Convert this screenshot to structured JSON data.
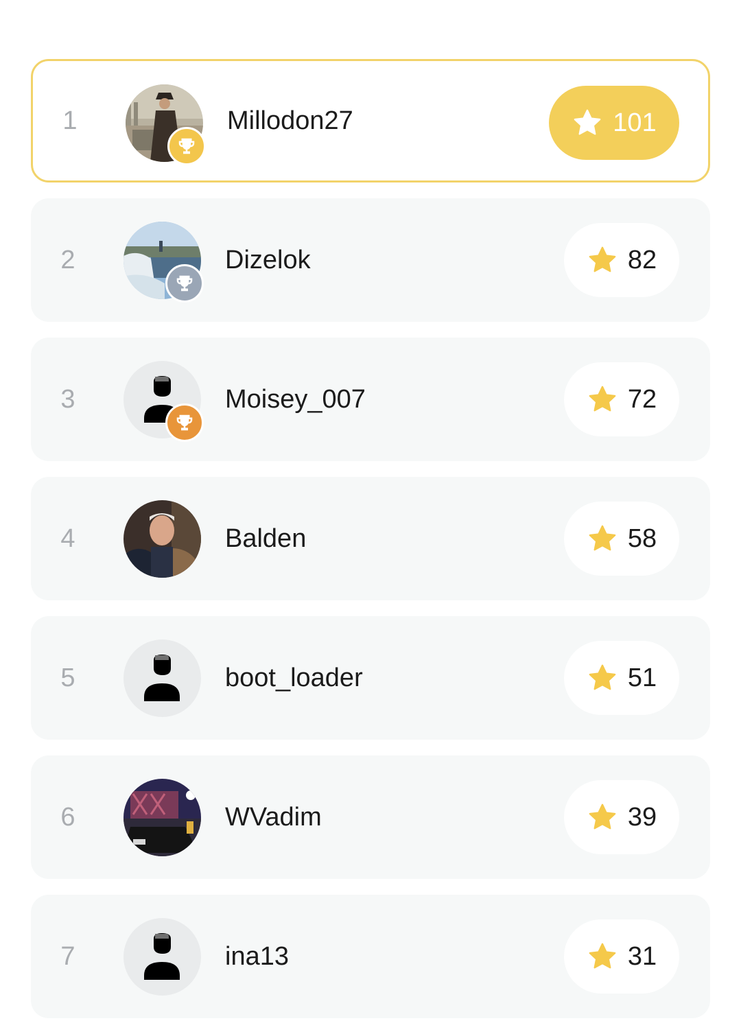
{
  "leaderboard": [
    {
      "rank": "1",
      "name": "Millodon27",
      "score": "101",
      "avatar": "photo-man-coat",
      "trophy": "gold"
    },
    {
      "rank": "2",
      "name": "Dizelok",
      "score": "82",
      "avatar": "photo-ice-river",
      "trophy": "silver"
    },
    {
      "rank": "3",
      "name": "Moisey_007",
      "score": "72",
      "avatar": "default-user-icon",
      "trophy": "bronze"
    },
    {
      "rank": "4",
      "name": "Balden",
      "score": "58",
      "avatar": "photo-face",
      "trophy": null
    },
    {
      "rank": "5",
      "name": "boot_loader",
      "score": "51",
      "avatar": "default-user-icon",
      "trophy": null
    },
    {
      "rank": "6",
      "name": "WVadim",
      "score": "39",
      "avatar": "photo-night-car",
      "trophy": null
    },
    {
      "rank": "7",
      "name": "ina13",
      "score": "31",
      "avatar": "default-user-icon",
      "trophy": null
    }
  ],
  "colors": {
    "accent": "#f3cf5a",
    "highlight_border": "#f2d36a",
    "row_bg": "#f6f8f8",
    "star": "#f5c94a",
    "gold": "#f3c64c",
    "silver": "#9aa6b6",
    "bronze": "#e8953a"
  },
  "icons": {
    "score": "star-icon",
    "badge": "trophy-icon",
    "default_avatar": "user-icon"
  }
}
